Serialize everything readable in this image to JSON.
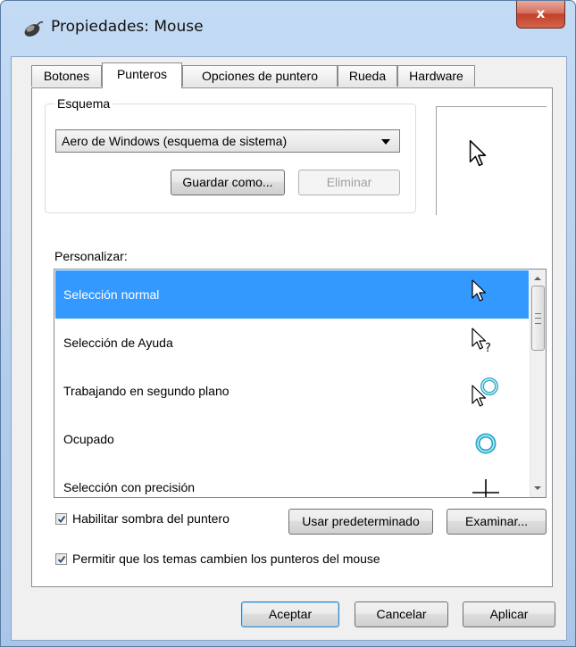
{
  "window": {
    "title": "Propiedades: Mouse",
    "close_glyph": "x"
  },
  "tabs": [
    {
      "label": "Botones"
    },
    {
      "label": "Punteros"
    },
    {
      "label": "Opciones de puntero"
    },
    {
      "label": "Rueda"
    },
    {
      "label": "Hardware"
    }
  ],
  "active_tab": "Punteros",
  "scheme": {
    "group_label": "Esquema",
    "selected": "Aero de Windows (esquema de sistema)",
    "save_as_label": "Guardar como...",
    "delete_label": "Eliminar"
  },
  "customize": {
    "label": "Personalizar:",
    "items": [
      {
        "label": "Selección normal",
        "icon": "arrow-cursor-icon",
        "selected": true
      },
      {
        "label": "Selección de Ayuda",
        "icon": "help-cursor-icon",
        "selected": false
      },
      {
        "label": "Trabajando en segundo plano",
        "icon": "working-background-cursor-icon",
        "selected": false
      },
      {
        "label": "Ocupado",
        "icon": "busy-ring-cursor-icon",
        "selected": false
      },
      {
        "label": "Selección con precisión",
        "icon": "crosshair-cursor-icon",
        "selected": false
      }
    ]
  },
  "options": {
    "shadow_label": "Habilitar sombra del puntero",
    "shadow_checked": true,
    "use_default_label": "Usar predeterminado",
    "browse_label": "Examinar...",
    "themes_label": "Permitir que los temas cambien los punteros del mouse",
    "themes_checked": true
  },
  "footer": {
    "ok_label": "Aceptar",
    "cancel_label": "Cancelar",
    "apply_label": "Aplicar"
  },
  "colors": {
    "selection": "#3399ff",
    "close_button": "#c1412a"
  }
}
